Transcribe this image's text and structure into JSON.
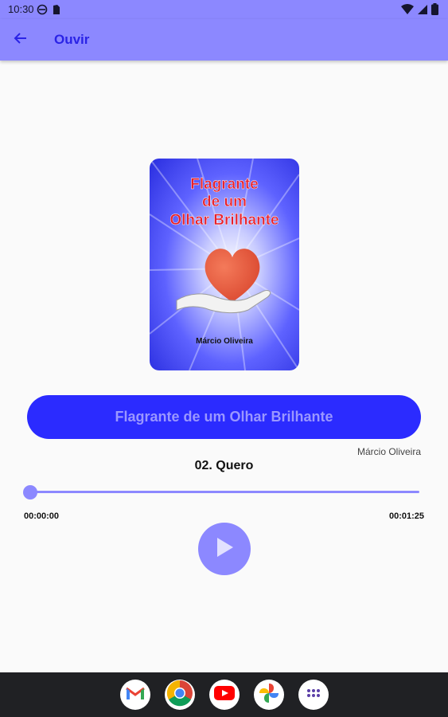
{
  "status_bar": {
    "time": "10:30"
  },
  "app_bar": {
    "title": "Ouvir"
  },
  "cover": {
    "title_lines": [
      "Flagrante",
      "de um",
      "Olhar Brilhante"
    ],
    "author": "Márcio Oliveira"
  },
  "player": {
    "book_title": "Flagrante de um Olhar Brilhante",
    "author": "Márcio Oliveira",
    "track_title": "02. Quero",
    "current_time": "00:00:00",
    "total_time": "00:01:25",
    "progress": 0
  },
  "dock": {
    "apps": [
      "gmail-icon",
      "chrome-icon",
      "youtube-icon",
      "photos-icon",
      "app-drawer-icon"
    ]
  },
  "colors": {
    "accent": "#8c88ff",
    "pill": "#2b2bff",
    "title_text": "#2a23e6",
    "cover_blue": "#3a3df5",
    "cover_title": "#e8202a"
  }
}
